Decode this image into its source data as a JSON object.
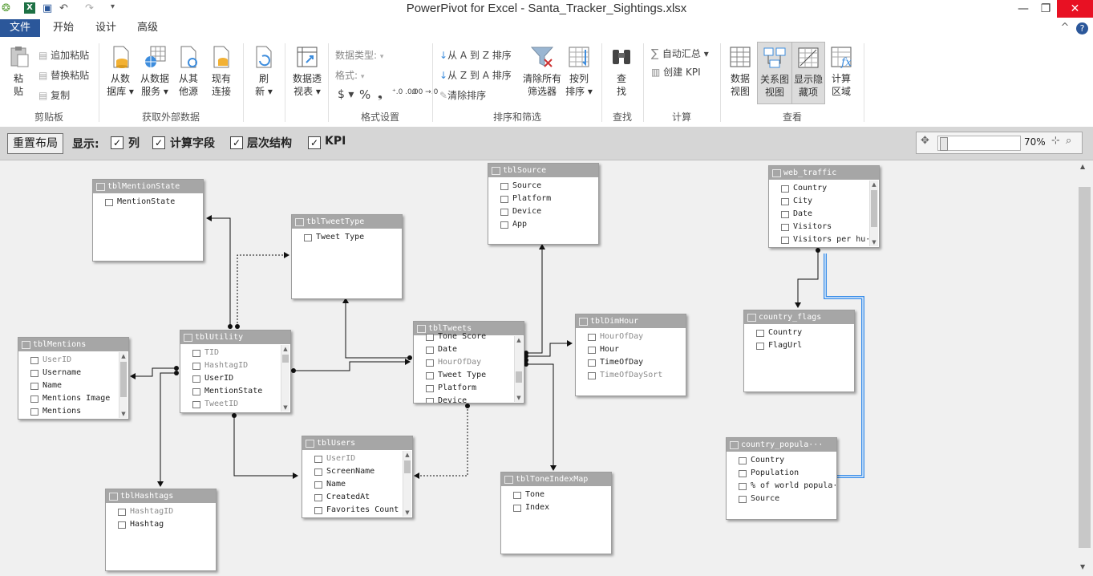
{
  "window": {
    "title": "PowerPivot for Excel - Santa_Tracker_Sightings.xlsx",
    "minimize": "—",
    "restore": "❐",
    "close": "✕"
  },
  "tabs": [
    {
      "label": "文件"
    },
    {
      "label": "开始"
    },
    {
      "label": "设计"
    },
    {
      "label": "高级"
    }
  ],
  "help_icon": "?",
  "collapse_icon": "^",
  "ribbon": {
    "clipboard": {
      "paste_line1": "粘",
      "paste_line2": "贴",
      "append_paste": "追加粘贴",
      "replace_paste": "替换粘贴",
      "copy": "复制",
      "group_label": "剪贴板"
    },
    "external": {
      "from_db_line1": "从数",
      "from_db_line2": "据库 ▾",
      "from_service_line1": "从数据",
      "from_service_line2": "服务 ▾",
      "from_other_line1": "从其",
      "from_other_line2": "他源",
      "existing_line1": "现有",
      "existing_line2": "连接",
      "group_label": "获取外部数据"
    },
    "refresh": {
      "line1": "刷",
      "line2": "新 ▾"
    },
    "pivot": {
      "line1": "数据透",
      "line2": "视表 ▾"
    },
    "format": {
      "data_type": "数据类型:",
      "format": "格式:",
      "currency": "$ ▾",
      "percent": "%",
      "comma": "❟",
      "inc_decimal": "⁺.0 .00",
      "dec_decimal": ".00 →.0",
      "group_label": "格式设置"
    },
    "sort": {
      "asc": "从 A 到 Z 排序",
      "desc": "从 Z 到 A 排序",
      "clear_sort": "清除排序",
      "clear_filters_line1": "清除所有",
      "clear_filters_line2": "筛选器",
      "by_col_line1": "按列",
      "by_col_line2": "排序 ▾",
      "group_label": "排序和筛选"
    },
    "find": {
      "line1": "查",
      "line2": "找",
      "group_label": "查找"
    },
    "calc": {
      "autosum": "自动汇总 ▾",
      "create_kpi": "创建 KPI",
      "group_label": "计算"
    },
    "view": {
      "data_view_line1": "数据",
      "data_view_line2": "视图",
      "diagram_line1": "关系图",
      "diagram_line2": "视图",
      "show_hidden_line1": "显示隐",
      "show_hidden_line2": "藏项",
      "calc_area_line1": "计算",
      "calc_area_line2": "区域",
      "group_label": "查看"
    }
  },
  "viewbar": {
    "reset_layout": "重置布局",
    "show_label": "显示:",
    "checkboxes": [
      {
        "label": "列",
        "checked": "✓"
      },
      {
        "label": "计算字段",
        "checked": "✓"
      },
      {
        "label": "层次结构",
        "checked": "✓"
      },
      {
        "label": "KPI",
        "checked": "✓"
      }
    ],
    "zoom": "70%"
  },
  "tables": {
    "mentionstate": {
      "name": "tblMentionState",
      "fields": [
        "MentionState"
      ]
    },
    "tweettype": {
      "name": "tblTweetType",
      "fields": [
        "Tweet Type"
      ]
    },
    "source": {
      "name": "tblSource",
      "fields": [
        "Source",
        "Platform",
        "Device",
        "App"
      ]
    },
    "web_traffic": {
      "name": "web_traffic",
      "fields": [
        "Country",
        "City",
        "Date",
        "Visitors",
        "Visitors per hu···"
      ]
    },
    "mentions": {
      "name": "tblMentions",
      "fields": [
        "UserID",
        "Username",
        "Name",
        "Mentions Image",
        "Mentions"
      ]
    },
    "utility": {
      "name": "tblUtility",
      "fields": [
        "TID",
        "HashtagID",
        "UserID",
        "MentionState",
        "TweetID"
      ]
    },
    "tweets": {
      "name": "tblTweets",
      "fields": [
        "Tone Score",
        "Date",
        "HourOfDay",
        "Tweet Type",
        "Platform",
        "Device"
      ]
    },
    "dimhour": {
      "name": "tblDimHour",
      "fields": [
        "HourOfDay",
        "Hour",
        "TimeOfDay",
        "TimeOfDaySort"
      ]
    },
    "country_flags": {
      "name": "country_flags",
      "fields": [
        "Country",
        "FlagUrl"
      ]
    },
    "users": {
      "name": "tblUsers",
      "fields": [
        "UserID",
        "ScreenName",
        "Name",
        "CreatedAt",
        "Favorites Count"
      ]
    },
    "toneindex": {
      "name": "tblToneIndexMap",
      "fields": [
        "Tone",
        "Index"
      ]
    },
    "hashtags": {
      "name": "tblHashtags",
      "fields": [
        "HashtagID",
        "Hashtag"
      ]
    },
    "country_popula": {
      "name": "country_popula···",
      "fields": [
        "Country",
        "Population",
        "% of world popula···",
        "Source"
      ]
    }
  }
}
